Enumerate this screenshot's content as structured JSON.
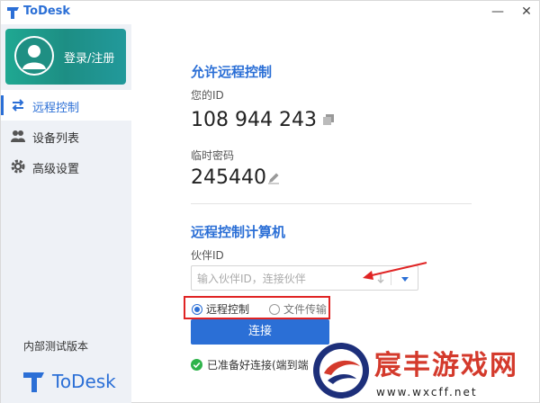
{
  "app": {
    "title": "ToDesk",
    "minimize_glyph": "—",
    "close_glyph": "✕"
  },
  "sidebar": {
    "login_label": "登录/注册",
    "items": [
      {
        "label": "远程控制",
        "icon": "swap-arrows-icon",
        "active": true
      },
      {
        "label": "设备列表",
        "icon": "users-icon",
        "active": false
      },
      {
        "label": "高级设置",
        "icon": "gear-icon",
        "active": false
      }
    ],
    "version_label": "内部测试版本",
    "brand_name": "ToDesk"
  },
  "allow": {
    "title": "允许远程控制",
    "id_label": "您的ID",
    "id_value": "108 944 243",
    "password_label": "临时密码",
    "password_value": "245440"
  },
  "control": {
    "title": "远程控制计算机",
    "partner_label": "伙伴ID",
    "partner_placeholder": "输入伙伴ID，连接伙伴",
    "partner_value": "",
    "mode_remote": "远程控制",
    "mode_file": "文件传输",
    "connect_label": "连接",
    "status_text": "已准备好连接(端到端"
  },
  "colors": {
    "accent": "#2b6fd6",
    "highlight": "#e02424",
    "login_gradient": "#1fa892"
  },
  "watermark": {
    "name": "宸丰游戏网",
    "url": "www.wxcff.net"
  }
}
